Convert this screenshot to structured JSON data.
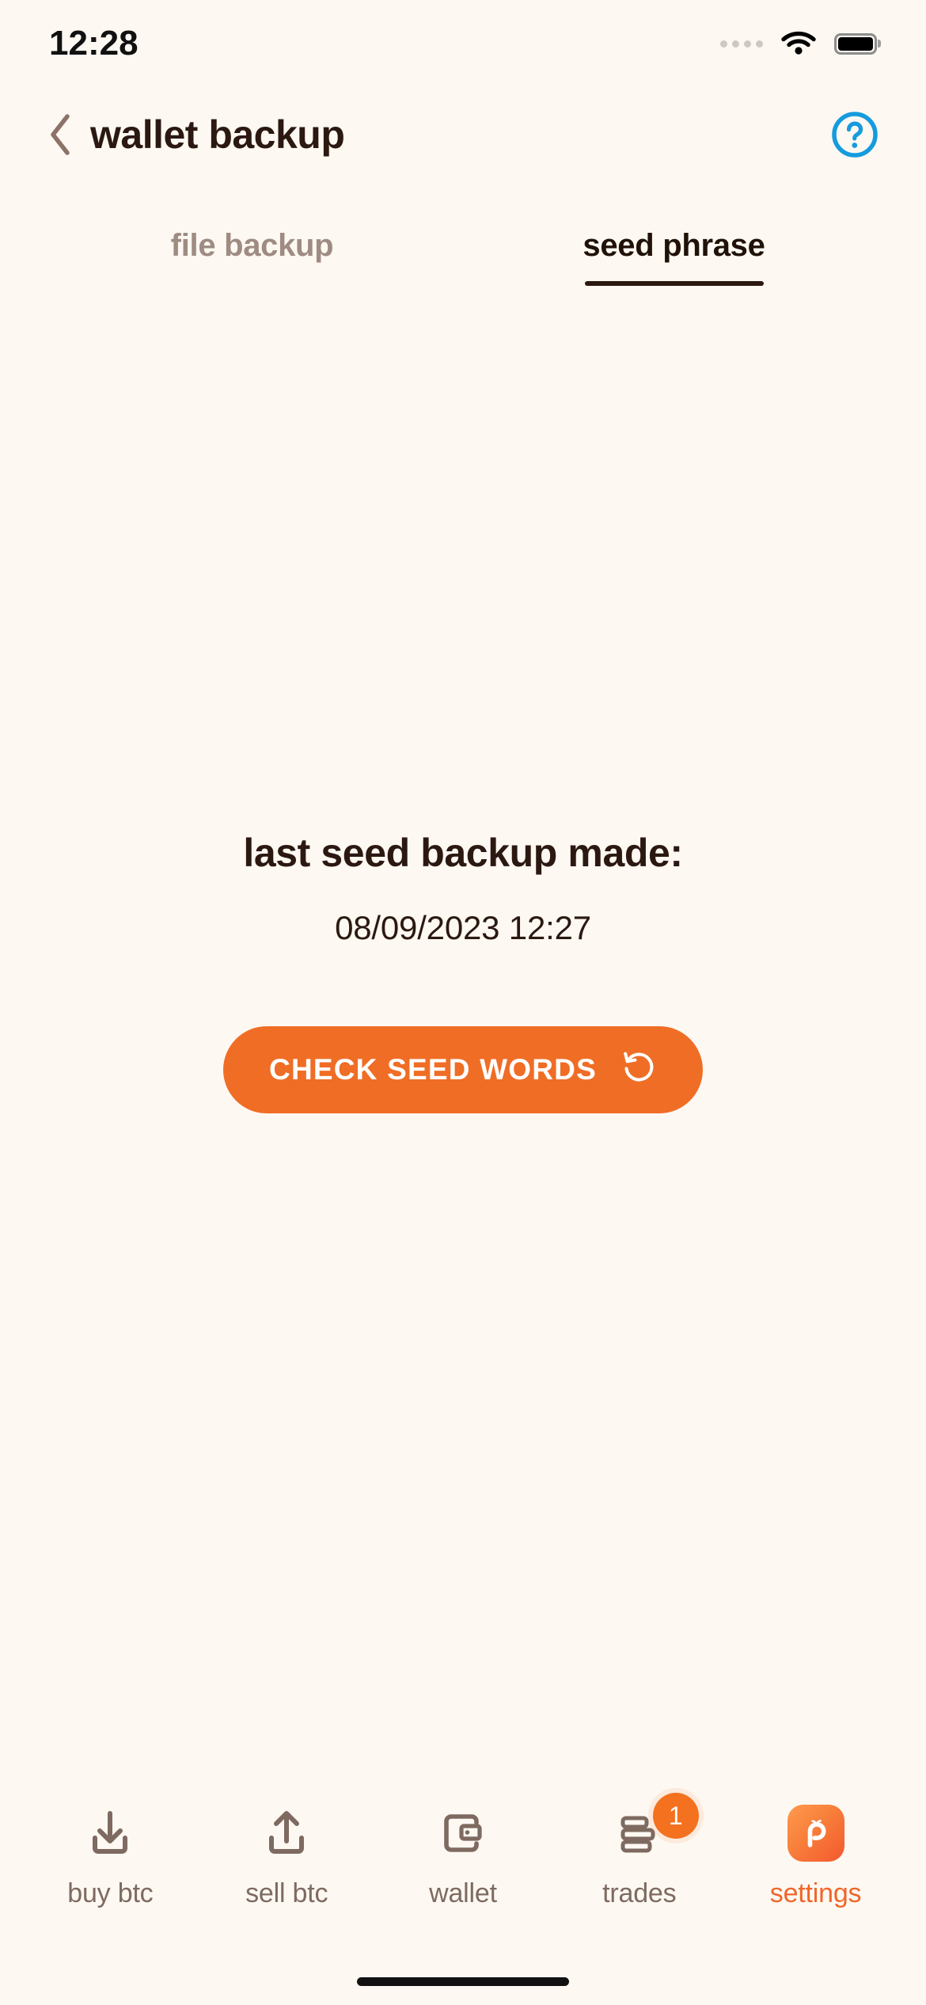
{
  "status_bar": {
    "time": "12:28",
    "signal_icon": "signal-dots-icon",
    "wifi_icon": "wifi-icon",
    "battery_icon": "battery-full-icon"
  },
  "header": {
    "back_icon": "chevron-left-icon",
    "title": "wallet backup",
    "help_icon": "help-circle-icon",
    "help_color": "#159BDE"
  },
  "tabs": [
    {
      "label": "file backup",
      "active": false
    },
    {
      "label": "seed phrase",
      "active": true
    }
  ],
  "main": {
    "backup_label": "last seed backup made:",
    "backup_date": "08/09/2023 12:27",
    "cta_label": "CHECK SEED WORDS",
    "cta_icon": "rotate-ccw-icon",
    "cta_color": "#F06D25"
  },
  "bottom_nav": {
    "items": [
      {
        "label": "buy btc",
        "icon": "download-tray-icon",
        "active": false,
        "badge": null
      },
      {
        "label": "sell btc",
        "icon": "upload-tray-icon",
        "active": false,
        "badge": null
      },
      {
        "label": "wallet",
        "icon": "wallet-icon",
        "active": false,
        "badge": null
      },
      {
        "label": "trades",
        "icon": "stacked-bills-icon",
        "active": false,
        "badge": "1"
      },
      {
        "label": "settings",
        "icon": "peach-logo-icon",
        "active": true,
        "badge": null
      }
    ],
    "active_color": "#F0662A",
    "inactive_color": "#7E6A60",
    "badge_color": "#F4711F"
  },
  "theme": {
    "background": "#FDF8F2",
    "text_dark": "#2B1911",
    "text_muted": "#9E8B82",
    "accent_orange": "#F06D25"
  }
}
